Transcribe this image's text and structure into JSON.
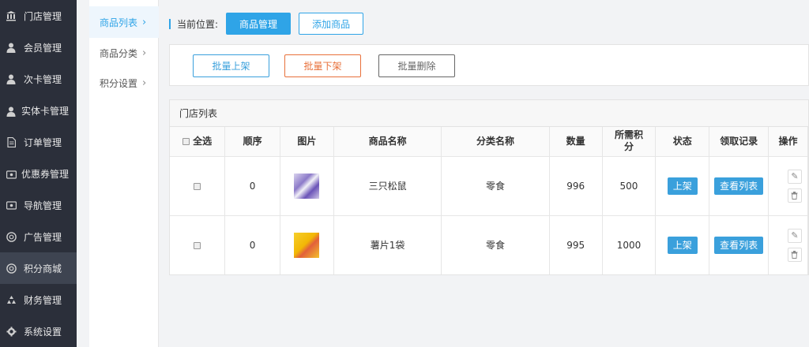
{
  "sidebar": {
    "items": [
      {
        "label": "门店管理",
        "icon": "bank-icon"
      },
      {
        "label": "会员管理",
        "icon": "user-icon"
      },
      {
        "label": "次卡管理",
        "icon": "user-icon"
      },
      {
        "label": "实体卡管理",
        "icon": "user-icon"
      },
      {
        "label": "订单管理",
        "icon": "document-icon"
      },
      {
        "label": "优惠券管理",
        "icon": "ticket-icon"
      },
      {
        "label": "导航管理",
        "icon": "ticket-icon"
      },
      {
        "label": "广告管理",
        "icon": "globe-icon"
      },
      {
        "label": "积分商城",
        "icon": "globe-icon"
      },
      {
        "label": "财务管理",
        "icon": "recycle-icon"
      },
      {
        "label": "系统设置",
        "icon": "gear-icon"
      }
    ],
    "active_index": 8
  },
  "submenu": {
    "items": [
      {
        "label": "商品列表"
      },
      {
        "label": "商品分类"
      },
      {
        "label": "积分设置"
      }
    ],
    "active_index": 0
  },
  "breadcrumb": {
    "label": "当前位置:",
    "current": "商品管理",
    "add_button": "添加商品"
  },
  "actions": {
    "batch_up": "批量上架",
    "batch_down": "批量下架",
    "batch_delete": "批量删除"
  },
  "list": {
    "title": "门店列表",
    "headers": {
      "select_all": "全选",
      "order": "顺序",
      "image": "图片",
      "name": "商品名称",
      "category": "分类名称",
      "quantity": "数量",
      "points_line1": "所需积",
      "points_line2": "分",
      "status": "状态",
      "records": "领取记录",
      "ops": "操作"
    },
    "rows": [
      {
        "order": "0",
        "name": "三只松鼠",
        "category": "零食",
        "quantity": "996",
        "points": "500",
        "status": "上架",
        "records": "查看列表"
      },
      {
        "order": "0",
        "name": "薯片1袋",
        "category": "零食",
        "quantity": "995",
        "points": "1000",
        "status": "上架",
        "records": "查看列表"
      }
    ]
  },
  "colors": {
    "sidebar_bg": "#2b2f3a",
    "accent": "#2fa4e7",
    "danger_outline": "#e8703a"
  }
}
